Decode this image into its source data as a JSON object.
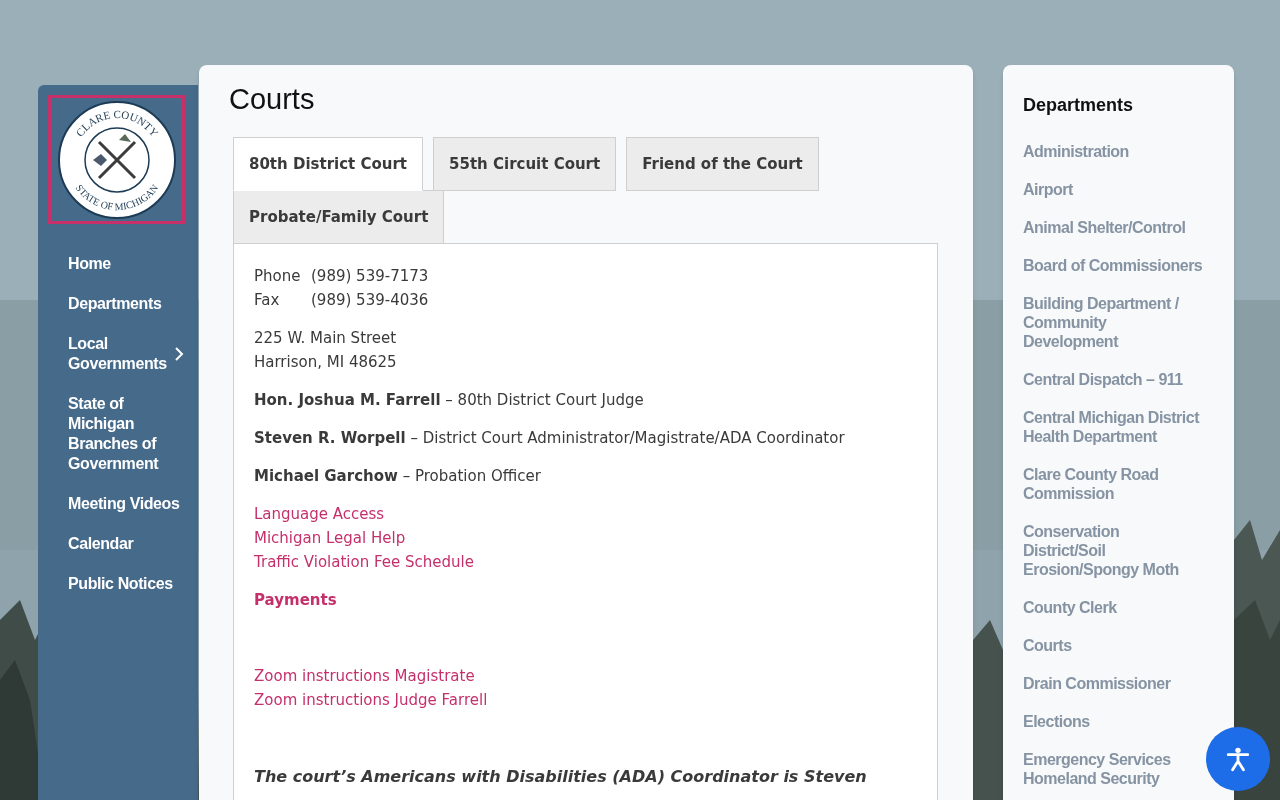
{
  "logo": {
    "top_text": "CLARE COUNTY",
    "bottom_text": "STATE OF MICHIGAN"
  },
  "nav": [
    {
      "label": "Home",
      "has_submenu": false
    },
    {
      "label": "Departments",
      "has_submenu": false
    },
    {
      "label": "Local Governments",
      "has_submenu": true
    },
    {
      "label": "State of Michigan Branches of Government",
      "has_submenu": false
    },
    {
      "label": "Meeting Videos",
      "has_submenu": false
    },
    {
      "label": "Calendar",
      "has_submenu": false
    },
    {
      "label": "Public Notices",
      "has_submenu": false
    }
  ],
  "page_title": "Courts",
  "tabs": [
    {
      "label": "80th District Court",
      "selected": true
    },
    {
      "label": "55th Circuit Court",
      "selected": false
    },
    {
      "label": "Friend of the Court",
      "selected": false
    },
    {
      "label": "Probate/Family Court",
      "selected": false
    }
  ],
  "contact": [
    {
      "label": "Phone",
      "value": "(989) 539-7173"
    },
    {
      "label": "Fax",
      "value": "(989) 539-4036"
    }
  ],
  "address": [
    "225 W. Main Street",
    "Harrison, MI 48625"
  ],
  "people": [
    "**Hon. Joshua M. Farrell** – 80th District Court Judge",
    "**Steven R. Worpell** – District Court Administrator/Magistrate/ADA Coordinator",
    "**Michael Garchow** – Probation Officer"
  ],
  "links": [
    "Language Access",
    "Michigan Legal Help",
    "Traffic Violation Fee Schedule"
  ],
  "payments_link": "Payments",
  "zoom_links": [
    "Zoom instructions Magistrate",
    "Zoom instructions Judge Farrell"
  ],
  "ada_note": "The court’s Americans with Disabilities (ADA) Coordinator is Steven",
  "departments": {
    "title": "Departments",
    "items": [
      "Administration",
      "Airport",
      "Animal Shelter/Control",
      "Board of Commissioners",
      "Building Department / Community Development",
      "Central Dispatch – 911",
      "Central Michigan District Health Department",
      "Clare County Road Commission",
      "Conservation District/Soil Erosion/Spongy Moth",
      "County Clerk",
      "Courts",
      "Drain Commissioner",
      "Elections",
      "Emergency Services Homeland Security"
    ]
  }
}
